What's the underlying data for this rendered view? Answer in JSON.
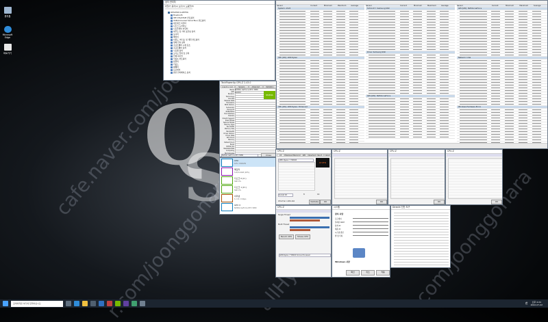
{
  "watermark": {
    "left": "cafe.naver.com/joonggonara",
    "mid": "r.com/joonggonara",
    "right": "com/joonggonara",
    "user": "allHyun"
  },
  "desktop_icons": [
    {
      "label": "휴지통",
      "color": "#9fb7d0"
    },
    {
      "label": "Microsoft Edge",
      "color": "#2f8cd9"
    },
    {
      "label": "바로가기",
      "color": "#e8e8e8"
    }
  ],
  "device_manager": {
    "title": "장치 관리자",
    "menu": "파일(F)  동작(A)  보기(V)  도움말(H)",
    "items": [
      "DESKTOP-1LEEF3K",
      "Bluetooth",
      "IDE ATA/ATAPI 컨트롤러",
      "USB(Universal Serial Bus) 컨트롤러",
      "네트워크 어댑터",
      "디스크 드라이브",
      "디스플레이 어댑터",
      "마우스 및 기타 포인팅 장치",
      "모니터",
      "배터리",
      "사운드, 비디오 및 게임 컨트롤러",
      "생체 인식 장치",
      "소프트웨어 구성 요소",
      "소프트웨어 장치",
      "시스템 장치",
      "오디오 입력 및 출력",
      "인쇄 대기열",
      "저장소 컨트롤러",
      "컴퓨터",
      "키보드",
      "펌웨어",
      "프로세서",
      "휴먼 인터페이스 장치"
    ]
  },
  "hwinfo": {
    "columns": [
      "Sensor",
      "Current",
      "Minimum",
      "Maximum",
      "Average"
    ],
    "sections": [
      "System: ASUS",
      "CPU [#0]: AMD Ryzen",
      "CPU [#0]: AMD Ryzen: Enhanced",
      "S.M.A.R.T.: Samsung SSD",
      "Drive: Samsung SSD",
      "GPU [#0]: NVIDIA GeForce",
      "Network: Intel",
      "Windows Hardware Errors"
    ]
  },
  "gpuz": {
    "title": "TechPowerUp GPU-Z 2.43.0",
    "tabs": [
      "Graphics Card",
      "Sensors",
      "Advanced",
      "Validation"
    ],
    "labels": [
      "Name",
      "GPU",
      "Revision",
      "Technology",
      "Die Size",
      "Release Date",
      "Transistors",
      "BIOS Version",
      "Subvendor",
      "Device ID",
      "ROPs/TMUs",
      "Bus Interface",
      "Shaders",
      "DirectX Support",
      "Pixel Fillrate",
      "Texture Fillrate",
      "Memory Type",
      "Bus Width",
      "Memory Size",
      "Bandwidth",
      "Driver Version",
      "Driver Date",
      "GPU Clock",
      "Memory",
      "Default Clock",
      "Boost",
      "NVIDIA SLI",
      "Resizable BAR",
      "Computing",
      "Technologies"
    ],
    "name_value": "NVIDIA GeForce RTX 3080",
    "gpu_value": "GA102",
    "brand": "NVIDIA",
    "lookup": "Lookup",
    "close": "Close",
    "footer": "NVIDIA GeForce RTX 3080"
  },
  "task_manager": {
    "items": [
      {
        "label": "CPU",
        "sub": "10%  3.60GHz",
        "color": "#117dbb"
      },
      {
        "label": "메모리",
        "sub": "5.8/31.9GB (18%)",
        "color": "#8b12ae"
      },
      {
        "label": "디스크 0 (C:)",
        "sub": "SSD 0%",
        "color": "#4da60c"
      },
      {
        "label": "디스크 1 (D:)",
        "sub": "SSD 0%",
        "color": "#4da60c"
      },
      {
        "label": "이더넷",
        "sub": "S: 0  R: 0 Kbps",
        "color": "#a74f01"
      },
      {
        "label": "GPU 0",
        "sub": "NVIDIA GeForce RTX 3080",
        "color": "#117dbb"
      }
    ]
  },
  "cpuz": {
    "title": "CPU-Z",
    "tabs": [
      "CPU",
      "Mainboard",
      "Memory",
      "SPD",
      "Graphics",
      "Bench",
      "About"
    ],
    "name": "AMD Ryzen 7 5800X",
    "brand": "RYZEN",
    "selection": "Socket #1",
    "cores": "8",
    "threads": "16",
    "validate": "Validate",
    "ok": "OK",
    "version": "CPU-Z Ver. 1.98.0.x64"
  },
  "cpuz_bench": {
    "title": "CPU-Z",
    "bench": "Bench CPU",
    "stress": "Stress CPU",
    "reference": "AMD Ryzen 7 5800X 8-Core Processor",
    "single_thread": "Single Thread",
    "multi_thread": "Multi Thread"
  },
  "system_props": {
    "title": "시스템",
    "sections": [
      "장치 사양",
      "Windows 사양"
    ],
    "items": [
      "프로세서",
      "설치된 RAM",
      "장치 ID",
      "제품 ID",
      "시스템 종류",
      "펜 및 터치"
    ],
    "ok": "확인",
    "cancel": "취소",
    "apply": "적용"
  },
  "dxdiag": {
    "title": "DirectX 진단 도구"
  },
  "taskbar": {
    "search": "검색하려면 여기에 입력하십시오.",
    "time": "오후 4:24",
    "date": "2022-07-22",
    "lang": "한"
  }
}
